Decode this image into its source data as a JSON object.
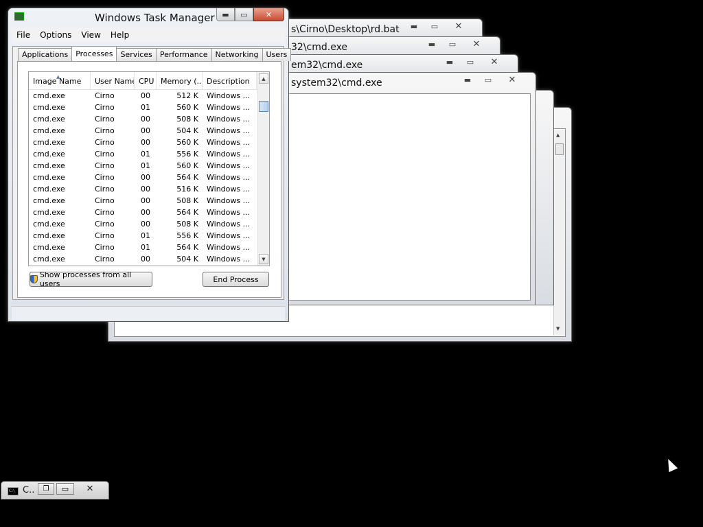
{
  "background_windows": [
    {
      "title": "s\\Cirno\\Desktop\\rd.bat"
    },
    {
      "title": "32\\cmd.exe"
    },
    {
      "title": "em32\\cmd.exe"
    },
    {
      "title": "system32\\cmd.exe"
    }
  ],
  "task_manager": {
    "title": "Windows Task Manager",
    "menu": [
      "File",
      "Options",
      "View",
      "Help"
    ],
    "tabs": [
      "Applications",
      "Processes",
      "Services",
      "Performance",
      "Networking",
      "Users"
    ],
    "active_tab": "Processes",
    "columns": [
      "Image Name",
      "User Name",
      "CPU",
      "Memory (...",
      "Description"
    ],
    "rows": [
      [
        "cmd.exe",
        "Cirno",
        "00",
        "512 K",
        "Windows ..."
      ],
      [
        "cmd.exe",
        "Cirno",
        "01",
        "560 K",
        "Windows ..."
      ],
      [
        "cmd.exe",
        "Cirno",
        "00",
        "508 K",
        "Windows ..."
      ],
      [
        "cmd.exe",
        "Cirno",
        "00",
        "504 K",
        "Windows ..."
      ],
      [
        "cmd.exe",
        "Cirno",
        "00",
        "560 K",
        "Windows ..."
      ],
      [
        "cmd.exe",
        "Cirno",
        "01",
        "556 K",
        "Windows ..."
      ],
      [
        "cmd.exe",
        "Cirno",
        "01",
        "560 K",
        "Windows ..."
      ],
      [
        "cmd.exe",
        "Cirno",
        "00",
        "564 K",
        "Windows ..."
      ],
      [
        "cmd.exe",
        "Cirno",
        "00",
        "516 K",
        "Windows ..."
      ],
      [
        "cmd.exe",
        "Cirno",
        "00",
        "508 K",
        "Windows ..."
      ],
      [
        "cmd.exe",
        "Cirno",
        "00",
        "564 K",
        "Windows ..."
      ],
      [
        "cmd.exe",
        "Cirno",
        "00",
        "508 K",
        "Windows ..."
      ],
      [
        "cmd.exe",
        "Cirno",
        "01",
        "556 K",
        "Windows ..."
      ],
      [
        "cmd.exe",
        "Cirno",
        "01",
        "564 K",
        "Windows ..."
      ],
      [
        "cmd.exe",
        "Cirno",
        "00",
        "504 K",
        "Windows ..."
      ]
    ],
    "show_all_button": "Show processes from all users",
    "end_process_button": "End Process"
  },
  "minimized_window": {
    "title": "C..."
  },
  "icons": [
    "minimize-icon",
    "maximize-icon",
    "restore-icon",
    "close-icon",
    "shield-icon",
    "cmd-icon",
    "mouse-cursor-icon"
  ]
}
